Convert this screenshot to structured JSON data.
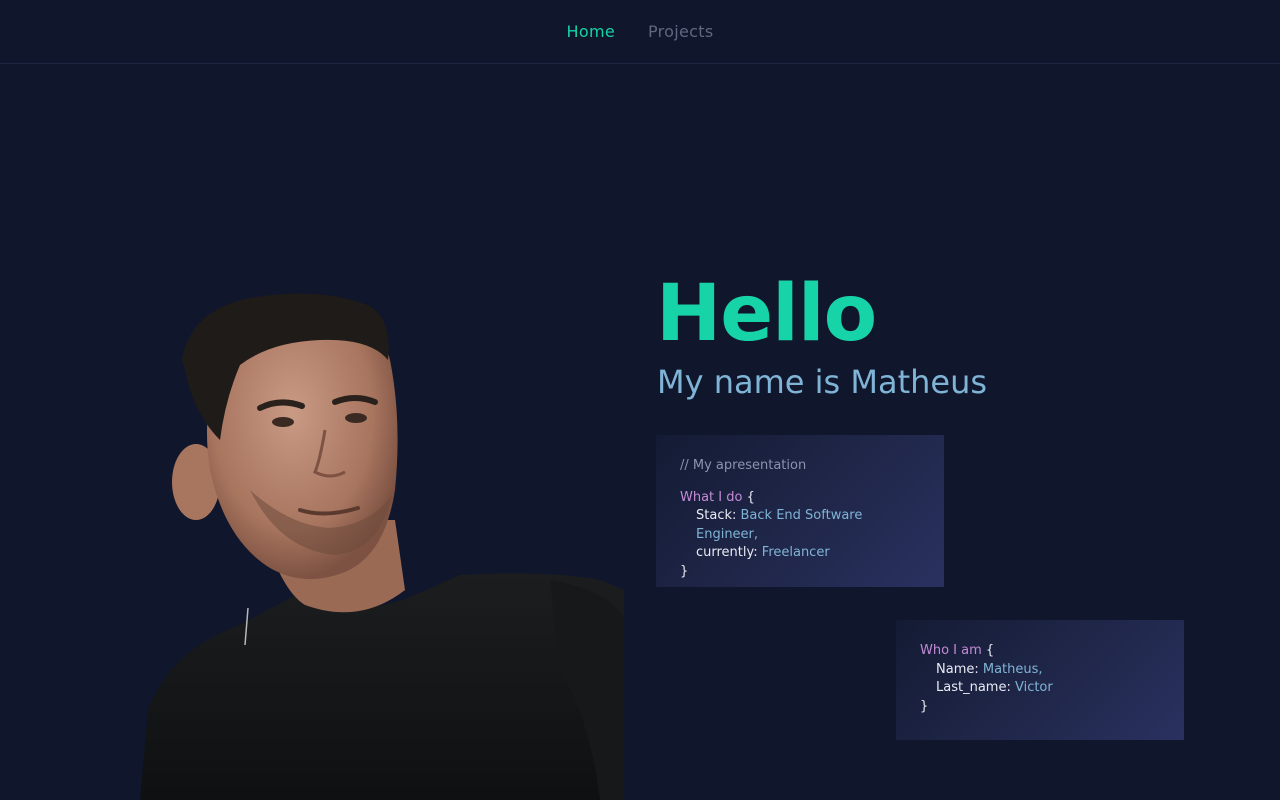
{
  "nav": {
    "items": [
      {
        "label": "Home",
        "active": true
      },
      {
        "label": "Projects",
        "active": false
      }
    ]
  },
  "hero": {
    "title": "Hello",
    "subtitle": "My name is Matheus"
  },
  "cards": {
    "presentation": {
      "comment": "// My apresentation",
      "block_name": "What I do",
      "open_brace": "{",
      "lines": [
        {
          "key": "Stack:",
          "value": "Back End Software Engineer,"
        },
        {
          "key": "currently:",
          "value": "Freelancer"
        }
      ],
      "close_brace": "}"
    },
    "whoami": {
      "block_name": "Who I am",
      "open_brace": "{",
      "lines": [
        {
          "key": "Name:",
          "value": "Matheus,"
        },
        {
          "key": "Last_name:",
          "value": "Victor"
        }
      ],
      "close_brace": "}"
    }
  },
  "colors": {
    "background": "#10162b",
    "accent": "#17d3a8",
    "subtitle": "#7fb4d6",
    "keyword": "#c48ad6"
  }
}
